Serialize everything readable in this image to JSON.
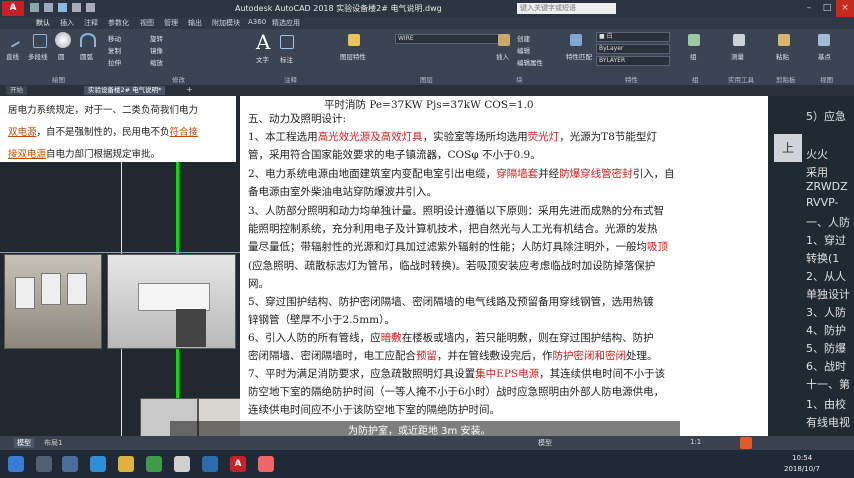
{
  "window": {
    "title": "Autodesk AutoCAD 2018    实验设备楼2# 电气说明.dwg",
    "search_placeholder": "键入关键字或短语",
    "logo_text": "A"
  },
  "ribbon_tabs": [
    "默认",
    "插入",
    "注释",
    "参数化",
    "视图",
    "管理",
    "输出",
    "附加模块",
    "A360",
    "精选应用"
  ],
  "ribbon": {
    "draw_items": [
      "直线",
      "多段线",
      "圆",
      "圆弧"
    ],
    "draw_label": "绘图",
    "modify_label": "修改",
    "modify_items": [
      "移动",
      "复制",
      "拉伸",
      "旋转",
      "镜像",
      "缩放"
    ],
    "annotation_label": "注释",
    "text_label": "文字",
    "dimension_label": "标注",
    "layers_label": "图层",
    "layer_name": "WIRE",
    "layer_props": "图层特性",
    "block_label": "块",
    "block_items": [
      "插入",
      "创建",
      "编辑",
      "编辑属性"
    ],
    "properties_label": "特性",
    "prop_match": "特性匹配",
    "bylayer1": "ByLayer",
    "bylayer2": "BYLAYER",
    "groups_label": "组",
    "group_btn": "组",
    "utilities_label": "实用工具",
    "measure": "测量",
    "clipboard_label": "剪贴板",
    "paste": "粘贴",
    "view_label": "视图",
    "base": "基点"
  },
  "doc_tabs": [
    "开始",
    "实验设备楼2# 电气说明*"
  ],
  "note": {
    "l1": "居电力系统规定，对于一、二类负荷我们电力",
    "l2a": "双电源",
    "l2b": "，自不是强制性的，民用电不负",
    "l2c": "符合接",
    "l3a": "接双电源",
    "l3b": "自电力部门根据规定审批。"
  },
  "doc": {
    "top_line": "平时消防  Pe=37KW   Pjs=37kW   COS=1.0",
    "heading": "五、动力及照明设计:",
    "p1a": "1、本工程选用",
    "p1r1": "高光效光源及高效灯具",
    "p1b": "，实验室等场所均选用",
    "p1r2": "荧光灯",
    "p1c": "，光源为T8节能型灯",
    "p1d": "管，采用符合国家能效要求的电子镇流器，COSφ 不小于0.9。",
    "p2a": "2、电力系统电源由地面建筑室内变配电室引出电缆，",
    "p2r1": "穿隔墙套",
    "p2b": "并经",
    "p2r2": "防爆穿线管密封",
    "p2c": "引入，自",
    "p2d": "备电源由室外柴油电站穿防爆波井引入。",
    "p3a": "3、人防部分照明和动力均单独计量。照明设计遵循以下原则：采用先进而成熟的分布式智",
    "p3b": "能照明控制系统，充分利用电子及计算机技术，把自然光与人工光有机结合。光源的发热",
    "p3c": "量尽量低；带辐射性的光源和灯具加过滤紫外辐射的性能；人防灯具除注明外，一般均",
    "p3r": "吸顶",
    "p3d": "(应急照明、疏散标志灯为管吊，临战时转换)。若吸顶安装应考虑临战时加设防掉落保护",
    "p3e": "网。",
    "p5a": "5、穿过围护结构、防护密闭隔墙、密闭隔墙的电气线路及预留备用穿线钢管，选用热镀",
    "p5b": "锌钢管（壁厚不小于2.5mm）。",
    "p6a": "6、引入人防的所有管线，应",
    "p6r1": "暗敷",
    "p6b": "在楼板或墙内，若只能明敷，则在穿过围护结构、防护",
    "p6c": "密闭隔墙、密闭隔墙时，电工应配合",
    "p6r2": "预留",
    "p6d": "，并在管线敷设完后，作",
    "p6r3": "防护密闭和密闭",
    "p6e": "处理。",
    "p7a": "7、平时为满足消防要求，应急疏散照明灯具设置",
    "p7r": "集中EPS电源",
    "p7b": "，其连续供电时间不小于该",
    "p7c": "防空地下室的隔绝防护时间（一等人掩不小于6小时）战时应急照明由外部人防电源供电，",
    "p7d": "连续供电时间应不小于该防空地下室的隔绝防护时间。",
    "subtitle": "为防护室，或近距地  3m 安装。"
  },
  "rightcol": {
    "lines": [
      "5）应急",
      "",
      "火火",
      "采用",
      "ZRWDZ",
      "RVVP-",
      "一、人防",
      "1、穿过",
      "转换(1",
      "2、从人",
      "单独设计",
      "3、人防",
      "4、防护",
      "5、防爆",
      "6、战时",
      "十一、第",
      "1、由校",
      "有线电视"
    ]
  },
  "status": {
    "model": "模型",
    "layout": "布局1",
    "zoom": "1:1"
  },
  "taskbar": {
    "time": "10:54",
    "date": "2018/10/7"
  },
  "colors": {
    "accent_red": "#d42020",
    "green_line": "#00e000"
  }
}
